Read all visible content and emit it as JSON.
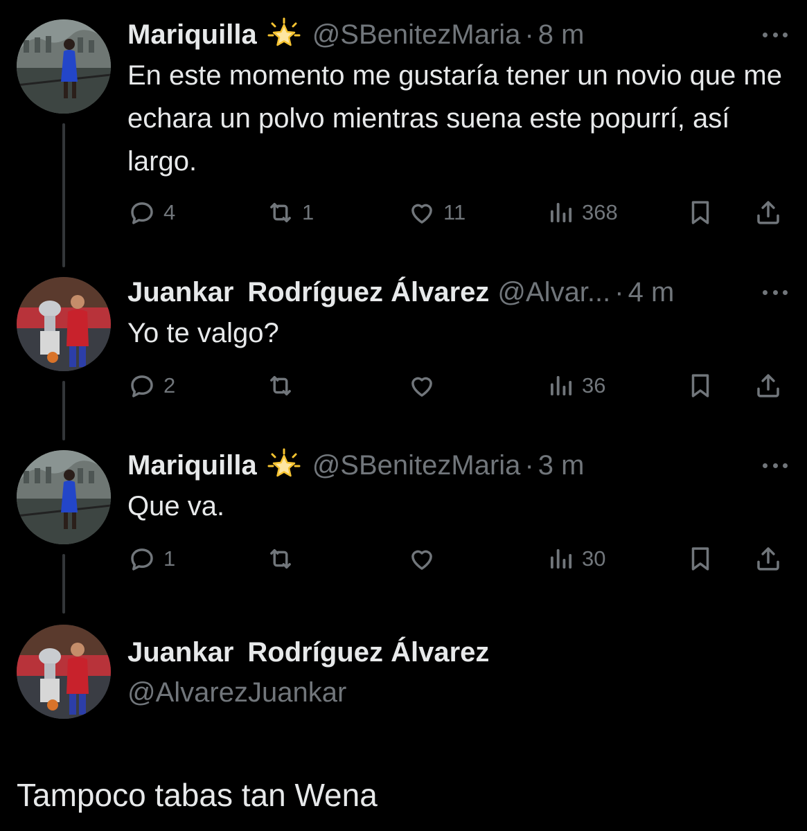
{
  "colors": {
    "background": "#000000",
    "text": "#e7e9ea",
    "muted": "#71767b",
    "thread_line": "#333639",
    "badge": "#f7c431"
  },
  "tweets": [
    {
      "name": "Mariquilla",
      "badge": "glowing-star-icon",
      "handle": "@SBenitezMaria",
      "time": "8 m",
      "text": "En este momento me gustaría tener un novio que me echara un polvo mientras suena este popurrí, así largo.",
      "replies": "4",
      "reposts": "1",
      "likes": "11",
      "views": "368"
    },
    {
      "name_first": "Juankar",
      "name_last": "Rodríguez Álvarez",
      "handle": "@Alvar...",
      "time": "4 m",
      "text": "Yo te valgo?",
      "replies": "2",
      "reposts": "",
      "likes": "",
      "views": "36"
    },
    {
      "name": "Mariquilla",
      "badge": "glowing-star-icon",
      "handle": "@SBenitezMaria",
      "time": "3 m",
      "text": "Que va.",
      "replies": "1",
      "reposts": "",
      "likes": "",
      "views": "30"
    }
  ],
  "composer": {
    "name_first": "Juankar",
    "name_last": "Rodríguez Álvarez",
    "handle": "@AlvarezJuankar"
  },
  "reply_text": "Tampoco tabas tan Wena"
}
